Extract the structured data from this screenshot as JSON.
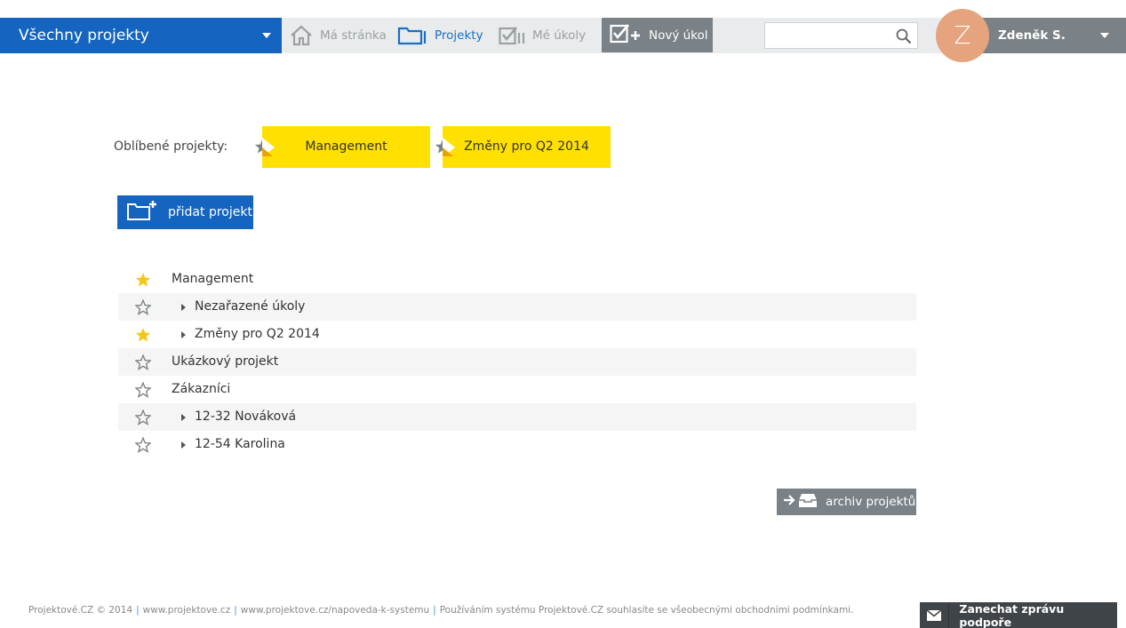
{
  "header": {
    "project_selector": "Všechny projekty",
    "nav": {
      "home": "Má stránka",
      "projects": "Projekty",
      "tasks": "Mé úkoly"
    },
    "new_task": "Nový úkol",
    "search_placeholder": "",
    "user": {
      "initial": "Z",
      "name": "Zdeněk S."
    }
  },
  "favorites": {
    "label": "Oblíbené projekty:",
    "items": [
      {
        "name": "Management"
      },
      {
        "name": "Změny pro Q2 2014"
      }
    ]
  },
  "add_project": "přidat projekt",
  "projects": [
    {
      "name": "Management",
      "starred": true,
      "level": 0
    },
    {
      "name": "Nezařazené úkoly",
      "starred": false,
      "level": 1
    },
    {
      "name": "Změny pro Q2 2014",
      "starred": true,
      "level": 1
    },
    {
      "name": "Ukázkový projekt",
      "starred": false,
      "level": 0
    },
    {
      "name": "Zákazníci",
      "starred": false,
      "level": 0
    },
    {
      "name": "12-32 Nováková",
      "starred": false,
      "level": 1
    },
    {
      "name": "12-54 Karolina",
      "starred": false,
      "level": 1
    }
  ],
  "archive": "archiv projektů",
  "footer": {
    "copyright": "Projektové.CZ © 2014",
    "link1": "www.projektove.cz",
    "link2": "www.projektove.cz/napoveda-k-systemu",
    "terms": "Používáním systému Projektové.CZ souhlasíte se všeobecnými obchodními podmínkami."
  },
  "support": "Zanechat zprávu podpoře",
  "colors": {
    "primary": "#1565c0",
    "favorite_card": "#ffe000",
    "star_active": "#f5c518",
    "gray_button": "#7b8287",
    "avatar": "#e5a47d"
  }
}
